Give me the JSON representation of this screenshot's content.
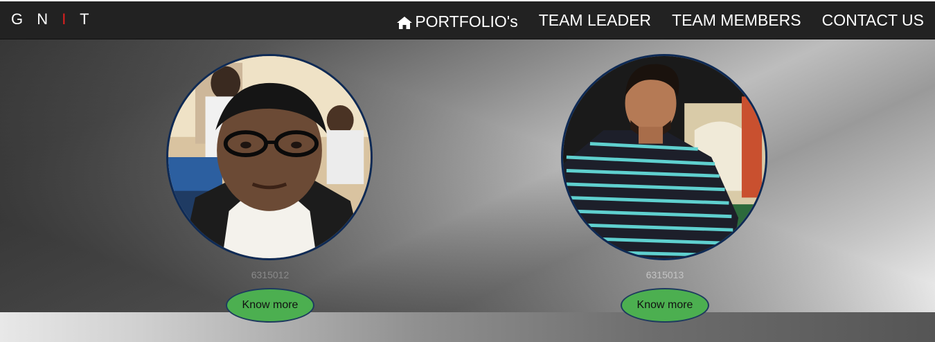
{
  "brand": {
    "part1": "G N ",
    "accent": "I",
    "part2": " T",
    "accent_color": "#e0201f"
  },
  "nav": {
    "items": [
      {
        "label": "PORTFOLIO's",
        "icon": "home-icon"
      },
      {
        "label": "TEAM LEADER"
      },
      {
        "label": "TEAM MEMBERS"
      },
      {
        "label": "CONTACT US"
      }
    ]
  },
  "members": [
    {
      "reg_no": "6315012",
      "button_label": "Know more"
    },
    {
      "reg_no": "6315013",
      "button_label": "Know more"
    }
  ],
  "colors": {
    "navbar": "#222222",
    "button": "#4caf50",
    "avatar_border": "#0e2a55"
  }
}
